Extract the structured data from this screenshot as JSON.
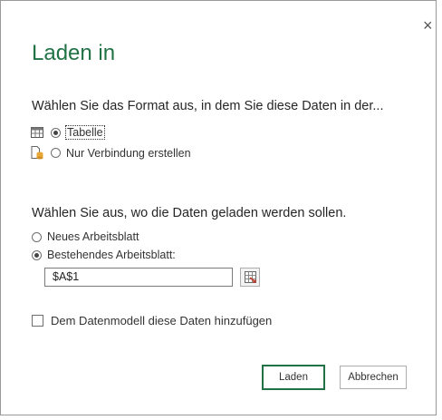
{
  "dialog": {
    "close_symbol": "×",
    "title": "Laden in",
    "format_question": "Wählen Sie das Format aus, in dem Sie diese Daten in der...",
    "format_options": [
      {
        "label": "Tabelle",
        "selected": true,
        "icon": "table-icon"
      },
      {
        "label": "Nur Verbindung erstellen",
        "selected": false,
        "icon": "connection-icon"
      }
    ],
    "location_question": "Wählen Sie aus, wo die Daten geladen werden sollen.",
    "location_options": [
      {
        "label": "Neues Arbeitsblatt",
        "selected": false
      },
      {
        "label": "Bestehendes Arbeitsblatt:",
        "selected": true
      }
    ],
    "cell_reference": "$A$1",
    "data_model_checkbox": {
      "label": "Dem Datenmodell diese Daten hinzufügen",
      "checked": false
    },
    "load_button": "Laden",
    "cancel_button": "Abbrechen"
  },
  "colors": {
    "accent": "#217346",
    "text": "#262626",
    "border": "#9a9a9a"
  }
}
